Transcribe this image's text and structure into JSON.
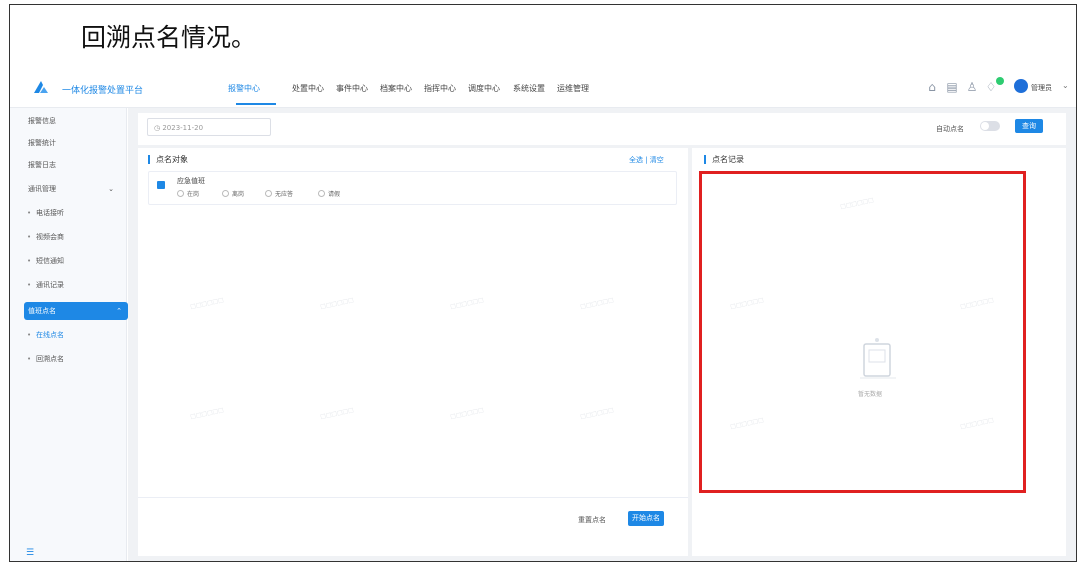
{
  "document": {
    "caption": "回溯点名情况。"
  },
  "app": {
    "title": "一体化报警处置平台",
    "logo_icon": "app-logo-icon"
  },
  "nav": {
    "items": [
      {
        "label": "报警中心",
        "active": true
      },
      {
        "label": "处置中心"
      },
      {
        "label": "事件中心"
      },
      {
        "label": "档案中心"
      },
      {
        "label": "指挥中心"
      },
      {
        "label": "调度中心"
      },
      {
        "label": "系统设置"
      },
      {
        "label": "运维管理"
      }
    ]
  },
  "topbar": {
    "icons": [
      "home-icon",
      "calendar-icon",
      "user-icon",
      "bell-icon"
    ],
    "username": "管理员",
    "accent": "#1e88e5"
  },
  "sidebar": {
    "items": [
      {
        "label": "报警信息"
      },
      {
        "label": "报警统计"
      },
      {
        "label": "报警日志"
      },
      {
        "label": "通讯管理",
        "has_caret": true
      },
      {
        "label": "电话接听",
        "sub": true
      },
      {
        "label": "视频会商",
        "sub": true
      },
      {
        "label": "短信通知",
        "sub": true
      },
      {
        "label": "通讯记录",
        "sub": true
      },
      {
        "label": "值班点名",
        "active": true,
        "has_caret": true
      },
      {
        "label": "在线点名",
        "sub": true,
        "subactive": true
      },
      {
        "label": "回溯点名",
        "sub": true
      }
    ]
  },
  "filter": {
    "date_value": "2023-11-20",
    "toggle_label": "自动点名",
    "query_label": "查询"
  },
  "left_panel": {
    "title": "点名对象",
    "links": "全选 | 清空",
    "target": {
      "name": "应急值班",
      "options": [
        "在岗",
        "离岗",
        "无应答",
        "请假"
      ]
    },
    "reset_label": "重置点名",
    "submit_label": "开始点名"
  },
  "right_panel": {
    "title": "点名记录",
    "empty_text": "暂无数据",
    "empty_icon": "empty-box-icon"
  },
  "annotation": {
    "highlight_color": "#e02020"
  },
  "watermark_text": "□□□□□□"
}
